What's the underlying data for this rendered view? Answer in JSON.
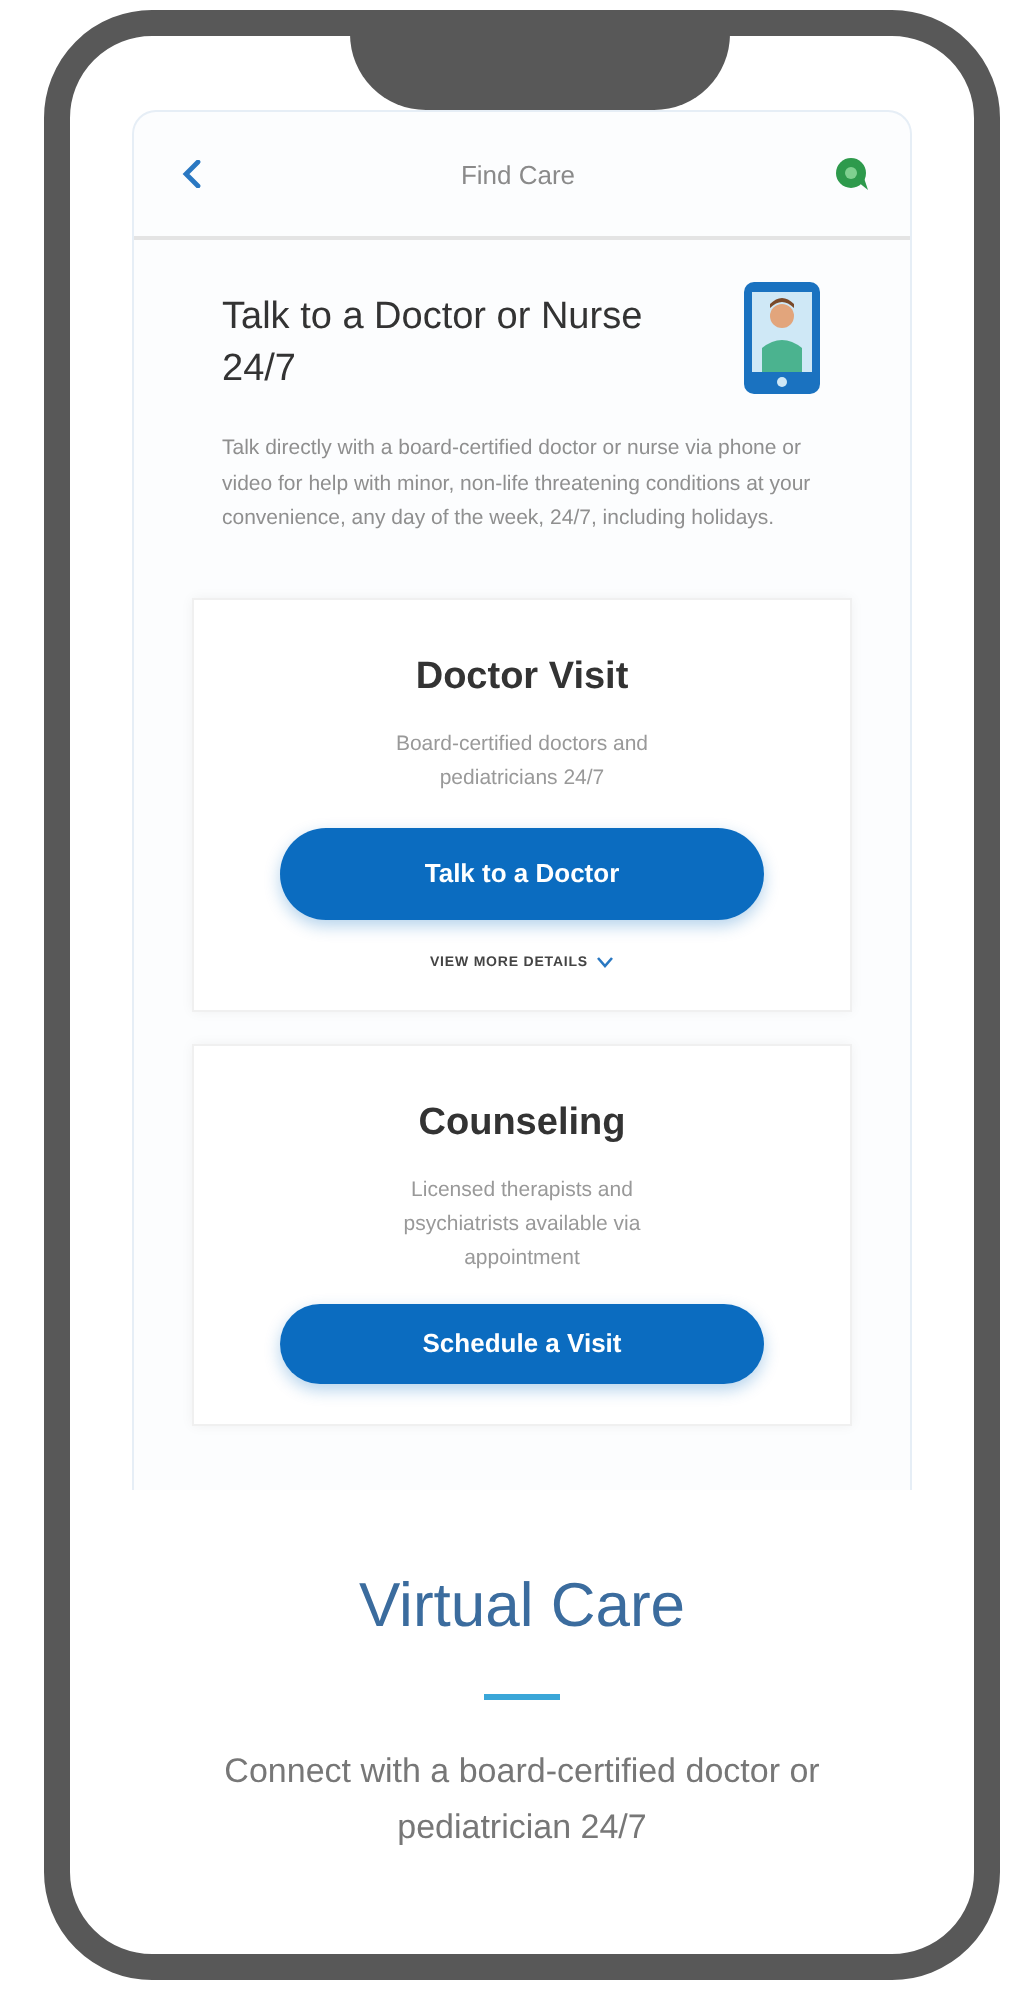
{
  "header": {
    "title": "Find Care"
  },
  "intro": {
    "title": "Talk to a Doctor or Nurse 24/7",
    "description": "Talk directly with a board-certified doctor or nurse via phone or video for help with minor, non-life threatening conditions at your convenience, any day of the week, 24/7, including holidays."
  },
  "services": [
    {
      "title": "Doctor Visit",
      "description": "Board-certified doctors and pediatricians 24/7",
      "button": "Talk to a Doctor",
      "details_link": "VIEW MORE DETAILS"
    },
    {
      "title": "Counseling",
      "description": "Licensed therapists and psychiatrists available via appointment",
      "button": "Schedule a Visit"
    }
  ],
  "footer": {
    "title": "Virtual Care",
    "tagline": "Connect with a board-certified doctor or pediatrician 24/7"
  }
}
